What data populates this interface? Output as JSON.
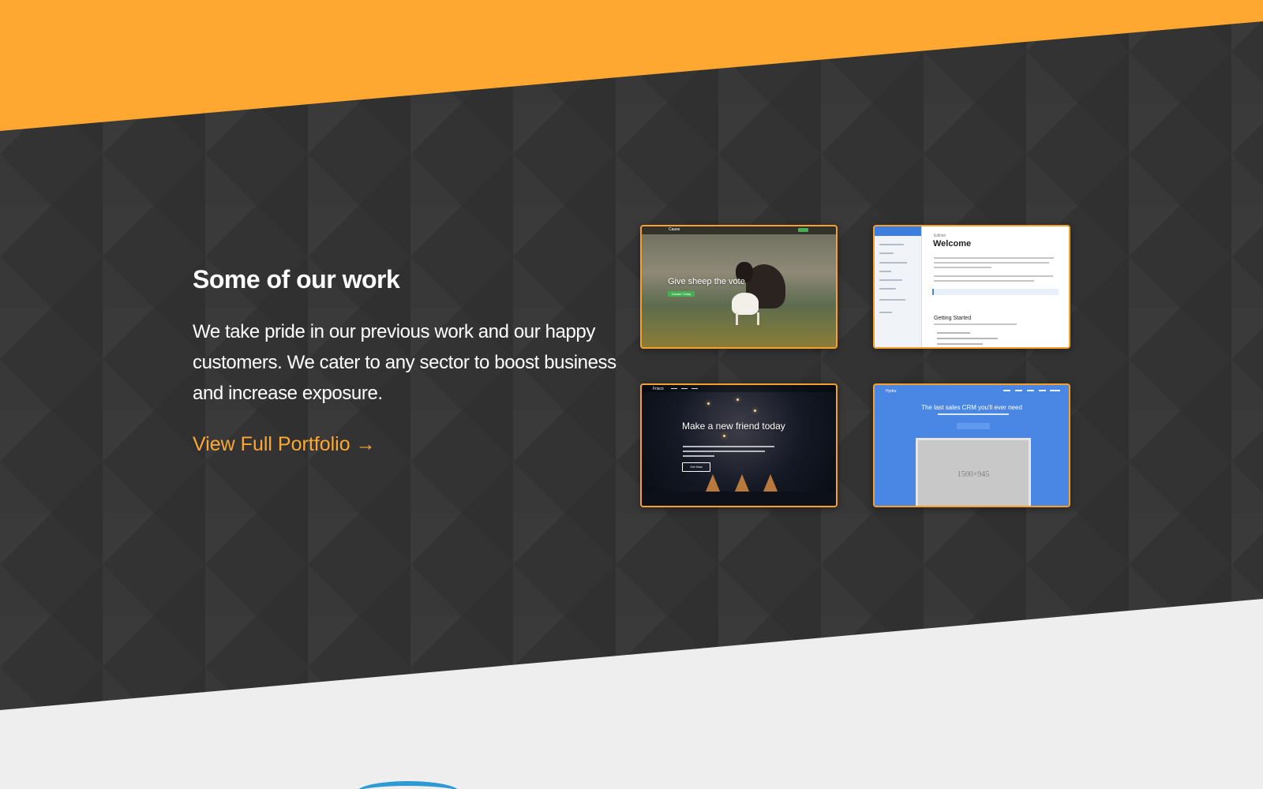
{
  "colors": {
    "accent": "#fea832",
    "dark_background": "#333333",
    "light_background": "#eeeeee",
    "title_text": "#ffffff",
    "crm_blue": "#4a87e4"
  },
  "portfolio": {
    "title": "Some of our work",
    "description": "We take pride in our previous work and our happy customers. We cater to any sector to boost business and increase exposure.",
    "link_label": "View Full Portfolio →",
    "link_icon": "right-arrow-icon"
  },
  "thumbnails": [
    {
      "brand": "Cause",
      "headline": "Give sheep the vote",
      "button": "Donate Today"
    },
    {
      "kicker": "Edition",
      "title": "Welcome",
      "subtitle": "Getting Started"
    },
    {
      "brand": "Frisco",
      "headline": "Make a new friend today",
      "button": "Get Now"
    },
    {
      "brand": "Hydra",
      "headline": "The last sales CRM you'll ever need",
      "placeholder_size": "1500×945"
    }
  ]
}
